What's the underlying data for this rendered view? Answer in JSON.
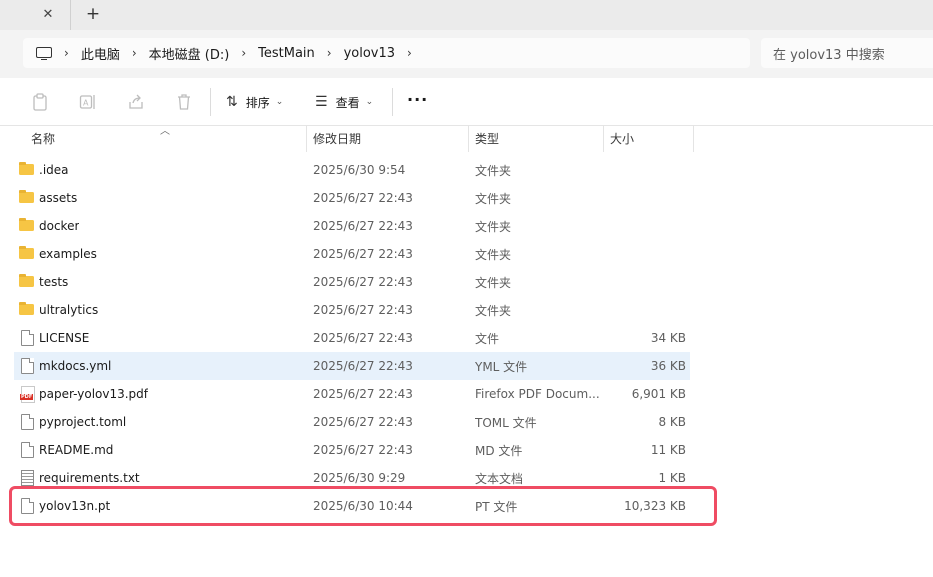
{
  "tabstrip": {
    "close_glyph": "✕",
    "new_tab_glyph": "+"
  },
  "breadcrumb": {
    "root_icon": "computer-icon",
    "chevron": "›",
    "items": [
      "此电脑",
      "本地磁盘 (D:)",
      "TestMain",
      "yolov13"
    ]
  },
  "search": {
    "placeholder": "在 yolov13 中搜索"
  },
  "toolbar": {
    "sort_label": "排序",
    "view_label": "查看",
    "more_label": "···"
  },
  "columns": {
    "name": "名称",
    "modified": "修改日期",
    "type": "类型",
    "size": "大小"
  },
  "files": [
    {
      "name": ".idea",
      "modified": "2025/6/30 9:54",
      "type": "文件夹",
      "size": "",
      "icon": "folder"
    },
    {
      "name": "assets",
      "modified": "2025/6/27 22:43",
      "type": "文件夹",
      "size": "",
      "icon": "folder"
    },
    {
      "name": "docker",
      "modified": "2025/6/27 22:43",
      "type": "文件夹",
      "size": "",
      "icon": "folder"
    },
    {
      "name": "examples",
      "modified": "2025/6/27 22:43",
      "type": "文件夹",
      "size": "",
      "icon": "folder"
    },
    {
      "name": "tests",
      "modified": "2025/6/27 22:43",
      "type": "文件夹",
      "size": "",
      "icon": "folder"
    },
    {
      "name": "ultralytics",
      "modified": "2025/6/27 22:43",
      "type": "文件夹",
      "size": "",
      "icon": "folder"
    },
    {
      "name": "LICENSE",
      "modified": "2025/6/27 22:43",
      "type": "文件",
      "size": "34 KB",
      "icon": "doc"
    },
    {
      "name": "mkdocs.yml",
      "modified": "2025/6/27 22:43",
      "type": "YML 文件",
      "size": "36 KB",
      "icon": "doc",
      "selected": true
    },
    {
      "name": "paper-yolov13.pdf",
      "modified": "2025/6/27 22:43",
      "type": "Firefox PDF Docum...",
      "size": "6,901 KB",
      "icon": "pdf"
    },
    {
      "name": "pyproject.toml",
      "modified": "2025/6/27 22:43",
      "type": "TOML 文件",
      "size": "8 KB",
      "icon": "doc"
    },
    {
      "name": "README.md",
      "modified": "2025/6/27 22:43",
      "type": "MD 文件",
      "size": "11 KB",
      "icon": "doc"
    },
    {
      "name": "requirements.txt",
      "modified": "2025/6/30 9:29",
      "type": "文本文档",
      "size": "1 KB",
      "icon": "txt"
    },
    {
      "name": "yolov13n.pt",
      "modified": "2025/6/30 10:44",
      "type": "PT 文件",
      "size": "10,323 KB",
      "icon": "doc",
      "highlighted": true
    }
  ],
  "colors": {
    "selection": "#e7f1fb",
    "highlight_border": "#ef4c63",
    "folder": "#f6c544"
  }
}
